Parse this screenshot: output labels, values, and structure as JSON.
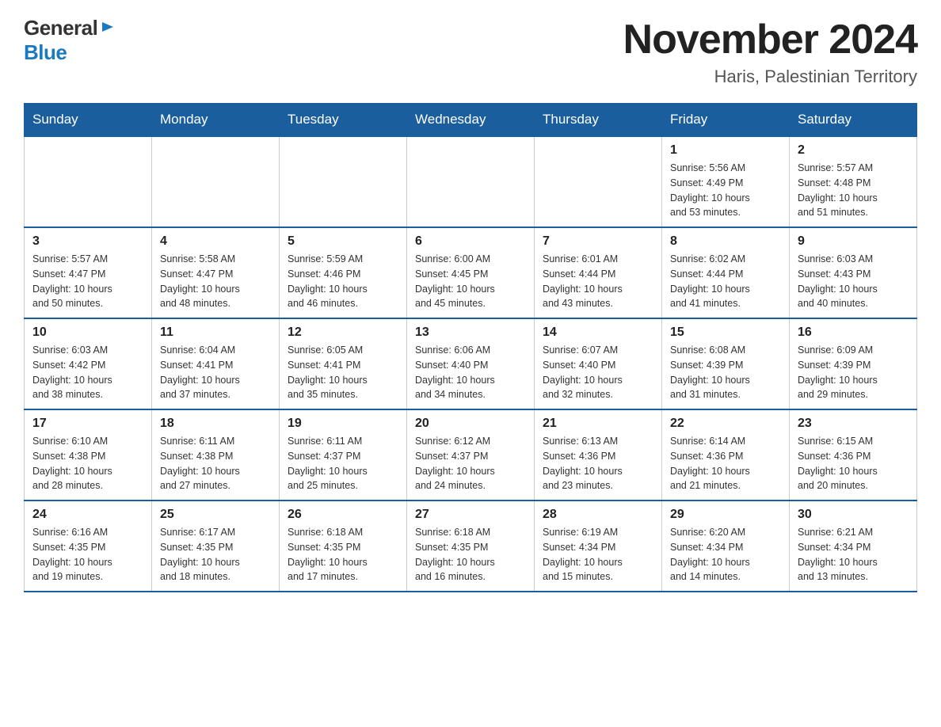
{
  "header": {
    "logo_general": "General",
    "logo_blue": "Blue",
    "month_title": "November 2024",
    "location": "Haris, Palestinian Territory"
  },
  "weekdays": [
    "Sunday",
    "Monday",
    "Tuesday",
    "Wednesday",
    "Thursday",
    "Friday",
    "Saturday"
  ],
  "weeks": [
    [
      {
        "day": "",
        "info": ""
      },
      {
        "day": "",
        "info": ""
      },
      {
        "day": "",
        "info": ""
      },
      {
        "day": "",
        "info": ""
      },
      {
        "day": "",
        "info": ""
      },
      {
        "day": "1",
        "info": "Sunrise: 5:56 AM\nSunset: 4:49 PM\nDaylight: 10 hours\nand 53 minutes."
      },
      {
        "day": "2",
        "info": "Sunrise: 5:57 AM\nSunset: 4:48 PM\nDaylight: 10 hours\nand 51 minutes."
      }
    ],
    [
      {
        "day": "3",
        "info": "Sunrise: 5:57 AM\nSunset: 4:47 PM\nDaylight: 10 hours\nand 50 minutes."
      },
      {
        "day": "4",
        "info": "Sunrise: 5:58 AM\nSunset: 4:47 PM\nDaylight: 10 hours\nand 48 minutes."
      },
      {
        "day": "5",
        "info": "Sunrise: 5:59 AM\nSunset: 4:46 PM\nDaylight: 10 hours\nand 46 minutes."
      },
      {
        "day": "6",
        "info": "Sunrise: 6:00 AM\nSunset: 4:45 PM\nDaylight: 10 hours\nand 45 minutes."
      },
      {
        "day": "7",
        "info": "Sunrise: 6:01 AM\nSunset: 4:44 PM\nDaylight: 10 hours\nand 43 minutes."
      },
      {
        "day": "8",
        "info": "Sunrise: 6:02 AM\nSunset: 4:44 PM\nDaylight: 10 hours\nand 41 minutes."
      },
      {
        "day": "9",
        "info": "Sunrise: 6:03 AM\nSunset: 4:43 PM\nDaylight: 10 hours\nand 40 minutes."
      }
    ],
    [
      {
        "day": "10",
        "info": "Sunrise: 6:03 AM\nSunset: 4:42 PM\nDaylight: 10 hours\nand 38 minutes."
      },
      {
        "day": "11",
        "info": "Sunrise: 6:04 AM\nSunset: 4:41 PM\nDaylight: 10 hours\nand 37 minutes."
      },
      {
        "day": "12",
        "info": "Sunrise: 6:05 AM\nSunset: 4:41 PM\nDaylight: 10 hours\nand 35 minutes."
      },
      {
        "day": "13",
        "info": "Sunrise: 6:06 AM\nSunset: 4:40 PM\nDaylight: 10 hours\nand 34 minutes."
      },
      {
        "day": "14",
        "info": "Sunrise: 6:07 AM\nSunset: 4:40 PM\nDaylight: 10 hours\nand 32 minutes."
      },
      {
        "day": "15",
        "info": "Sunrise: 6:08 AM\nSunset: 4:39 PM\nDaylight: 10 hours\nand 31 minutes."
      },
      {
        "day": "16",
        "info": "Sunrise: 6:09 AM\nSunset: 4:39 PM\nDaylight: 10 hours\nand 29 minutes."
      }
    ],
    [
      {
        "day": "17",
        "info": "Sunrise: 6:10 AM\nSunset: 4:38 PM\nDaylight: 10 hours\nand 28 minutes."
      },
      {
        "day": "18",
        "info": "Sunrise: 6:11 AM\nSunset: 4:38 PM\nDaylight: 10 hours\nand 27 minutes."
      },
      {
        "day": "19",
        "info": "Sunrise: 6:11 AM\nSunset: 4:37 PM\nDaylight: 10 hours\nand 25 minutes."
      },
      {
        "day": "20",
        "info": "Sunrise: 6:12 AM\nSunset: 4:37 PM\nDaylight: 10 hours\nand 24 minutes."
      },
      {
        "day": "21",
        "info": "Sunrise: 6:13 AM\nSunset: 4:36 PM\nDaylight: 10 hours\nand 23 minutes."
      },
      {
        "day": "22",
        "info": "Sunrise: 6:14 AM\nSunset: 4:36 PM\nDaylight: 10 hours\nand 21 minutes."
      },
      {
        "day": "23",
        "info": "Sunrise: 6:15 AM\nSunset: 4:36 PM\nDaylight: 10 hours\nand 20 minutes."
      }
    ],
    [
      {
        "day": "24",
        "info": "Sunrise: 6:16 AM\nSunset: 4:35 PM\nDaylight: 10 hours\nand 19 minutes."
      },
      {
        "day": "25",
        "info": "Sunrise: 6:17 AM\nSunset: 4:35 PM\nDaylight: 10 hours\nand 18 minutes."
      },
      {
        "day": "26",
        "info": "Sunrise: 6:18 AM\nSunset: 4:35 PM\nDaylight: 10 hours\nand 17 minutes."
      },
      {
        "day": "27",
        "info": "Sunrise: 6:18 AM\nSunset: 4:35 PM\nDaylight: 10 hours\nand 16 minutes."
      },
      {
        "day": "28",
        "info": "Sunrise: 6:19 AM\nSunset: 4:34 PM\nDaylight: 10 hours\nand 15 minutes."
      },
      {
        "day": "29",
        "info": "Sunrise: 6:20 AM\nSunset: 4:34 PM\nDaylight: 10 hours\nand 14 minutes."
      },
      {
        "day": "30",
        "info": "Sunrise: 6:21 AM\nSunset: 4:34 PM\nDaylight: 10 hours\nand 13 minutes."
      }
    ]
  ]
}
